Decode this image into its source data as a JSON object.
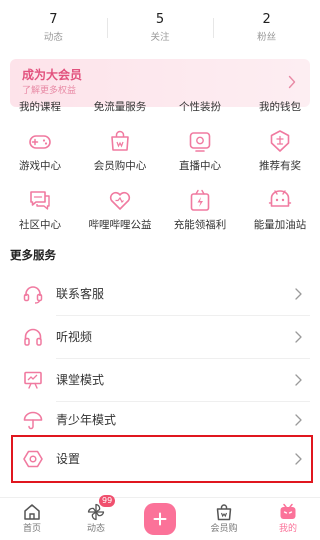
{
  "stats": [
    {
      "value": "7",
      "label": "动态"
    },
    {
      "value": "5",
      "label": "关注"
    },
    {
      "value": "2",
      "label": "粉丝"
    }
  ],
  "vip": {
    "title": "成为大会员",
    "subtitle": "了解更多权益"
  },
  "partial_row": [
    "我的课程",
    "免流量服务",
    "个性装扮",
    "我的钱包"
  ],
  "grid": [
    {
      "label": "游戏中心",
      "icon": "gamepad-icon"
    },
    {
      "label": "会员购中心",
      "icon": "shopping-bag-icon"
    },
    {
      "label": "直播中心",
      "icon": "live-tv-icon"
    },
    {
      "label": "推荐有奖",
      "icon": "reward-badge-icon"
    },
    {
      "label": "社区中心",
      "icon": "community-chat-icon"
    },
    {
      "label": "哔哩哔哩公益",
      "icon": "charity-heart-icon"
    },
    {
      "label": "充能领福利",
      "icon": "energy-gift-icon"
    },
    {
      "label": "能量加油站",
      "icon": "energy-station-icon"
    }
  ],
  "more_services": {
    "title": "更多服务",
    "items": [
      {
        "label": "联系客服",
        "icon": "headset-icon"
      },
      {
        "label": "听视频",
        "icon": "headphones-icon"
      },
      {
        "label": "课堂模式",
        "icon": "classroom-board-icon"
      },
      {
        "label": "青少年模式",
        "icon": "umbrella-icon"
      },
      {
        "label": "设置",
        "icon": "settings-hexagon-icon"
      }
    ]
  },
  "nav": {
    "items": [
      {
        "label": "首页",
        "icon": "home-icon"
      },
      {
        "label": "动态",
        "icon": "pinwheel-icon",
        "badge": "99"
      },
      {
        "label": "会员购",
        "icon": "shop-bag-icon"
      },
      {
        "label": "我的",
        "icon": "tv-mascot-icon"
      }
    ],
    "plus_icon": "plus-icon"
  },
  "colors": {
    "accent": "#fb7299",
    "highlight_border": "#e0171f"
  }
}
